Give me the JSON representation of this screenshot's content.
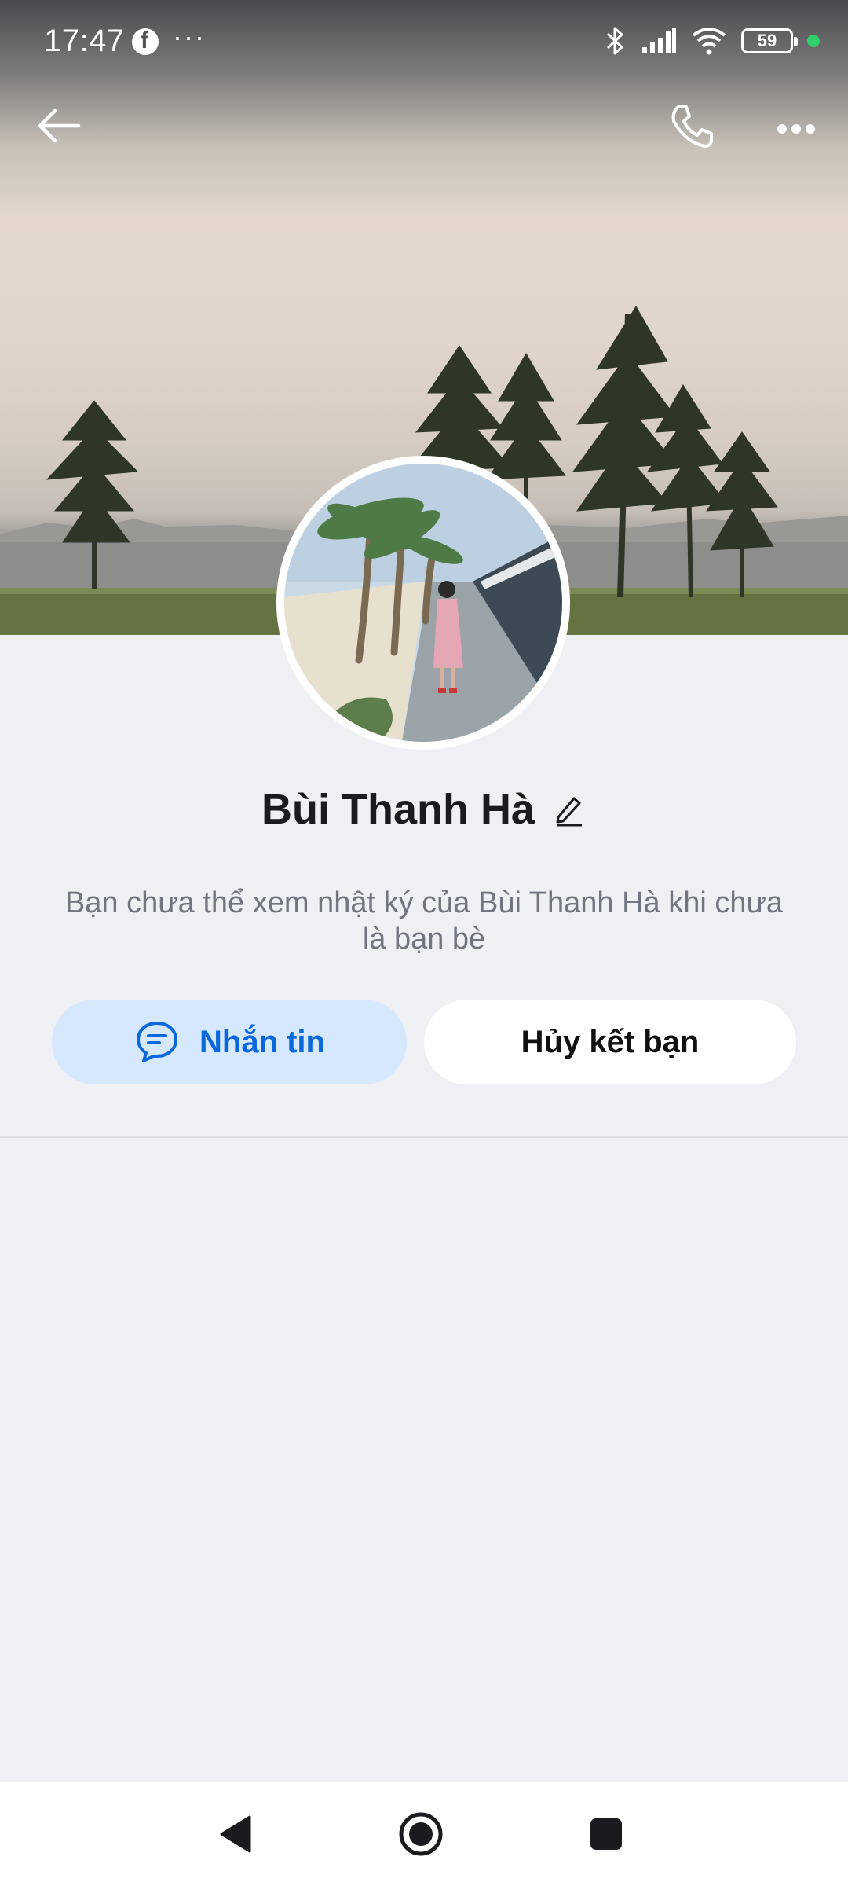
{
  "status_bar": {
    "time": "17:47",
    "battery": "59",
    "icons": [
      "facebook-icon",
      "more-dots-icon",
      "bluetooth-icon",
      "signal-icon",
      "wifi-icon",
      "battery-icon"
    ]
  },
  "app_bar": {
    "icons": [
      "back-arrow-icon",
      "phone-icon",
      "more-horizontal-icon"
    ]
  },
  "profile": {
    "name": "Bùi Thanh Hà",
    "notice": "Bạn chưa thể xem nhật ký của Bùi Thanh Hà khi chưa là bạn bè"
  },
  "actions": {
    "message_label": "Nhắn tin",
    "unfriend_label": "Hủy kết bạn"
  },
  "colors": {
    "accent": "#0a68dc",
    "message_bg": "#d6e8fd",
    "background": "#eff0f4"
  }
}
